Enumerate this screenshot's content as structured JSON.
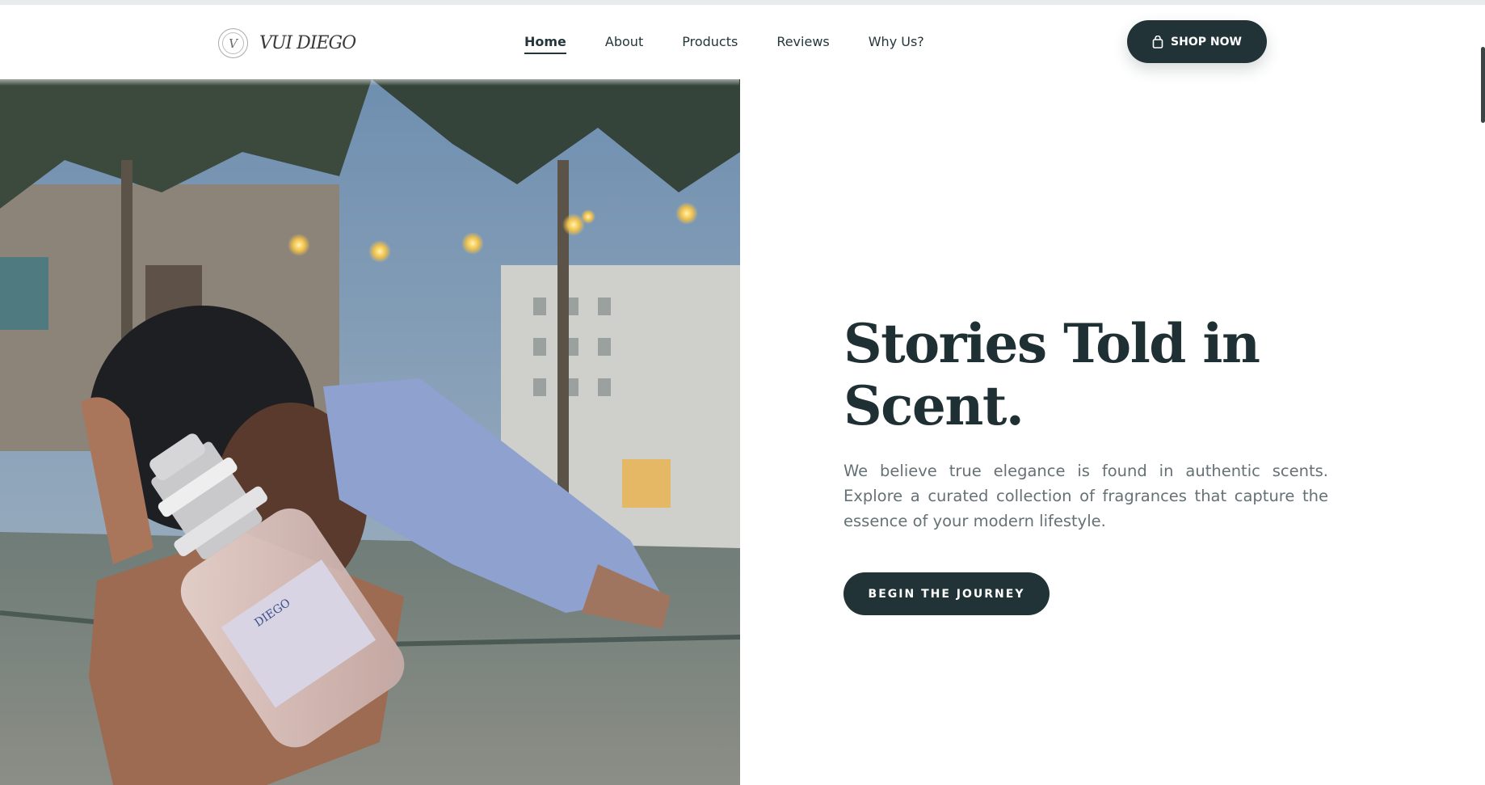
{
  "brand": {
    "logo_mark": "V",
    "logo_text": "VUI DIEGO"
  },
  "nav": {
    "items": [
      {
        "label": "Home",
        "active": true
      },
      {
        "label": "About",
        "active": false
      },
      {
        "label": "Products",
        "active": false
      },
      {
        "label": "Reviews",
        "active": false
      },
      {
        "label": "Why Us?",
        "active": false
      }
    ],
    "cta_icon": "shopping-bag-icon",
    "cta_label": "SHOP NOW"
  },
  "hero": {
    "image": "hero-photo",
    "bottle_label": "DIEGO",
    "title_line1": "Stories Told in",
    "title_line2": "Scent.",
    "description": "We believe true elegance is found in authentic scents. Explore a curated collection of fragrances that capture the essence of your modern lifestyle.",
    "button_label": "BEGIN THE JOURNEY"
  },
  "colors": {
    "primary": "#213337",
    "text_dark": "#1f3035",
    "text_muted": "#667175",
    "background": "#ffffff"
  }
}
